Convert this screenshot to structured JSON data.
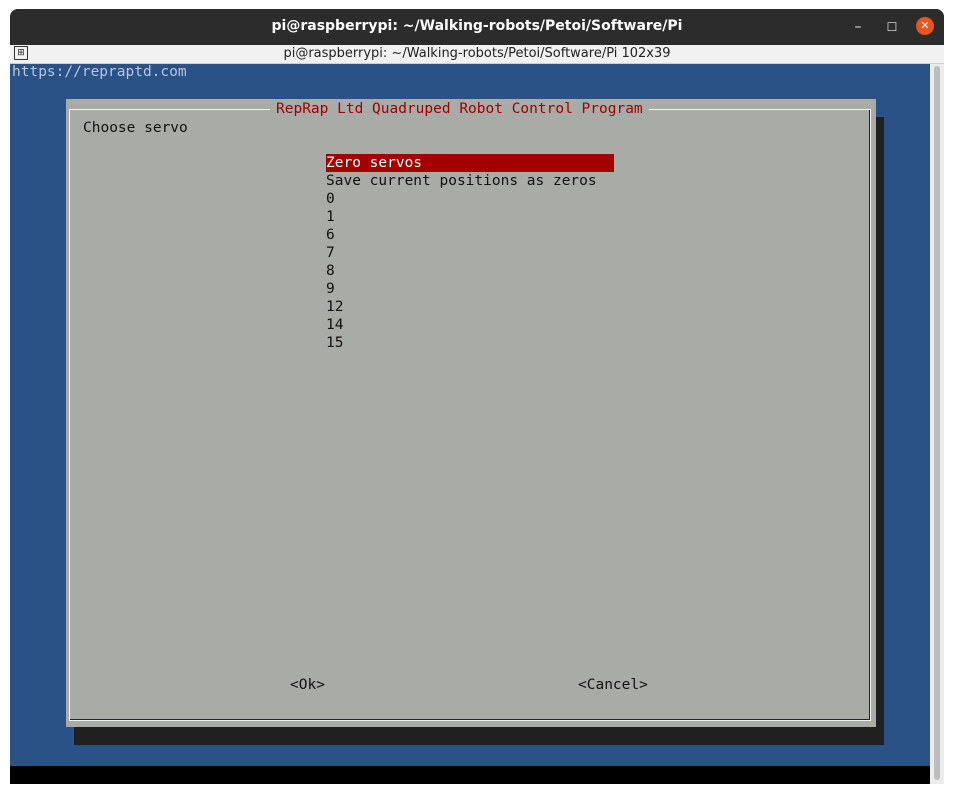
{
  "window": {
    "title": "pi@raspberrypi: ~/Walking-robots/Petoi/Software/Pi",
    "minimize_glyph": "–",
    "maximize_glyph": "☐",
    "close_glyph": "✕"
  },
  "tab": {
    "title": "pi@raspberrypi: ~/Walking-robots/Petoi/Software/Pi 102x39"
  },
  "terminal": {
    "backtitle": "https://repraptd.com"
  },
  "dialog": {
    "title": "RepRap Ltd Quadruped Robot Control Program",
    "prompt": "Choose servo",
    "items": [
      {
        "label": "Zero servos",
        "selected": true
      },
      {
        "label": "Save current positions as zeros",
        "selected": false
      },
      {
        "label": "0",
        "selected": false
      },
      {
        "label": "1",
        "selected": false
      },
      {
        "label": "6",
        "selected": false
      },
      {
        "label": "7",
        "selected": false
      },
      {
        "label": "8",
        "selected": false
      },
      {
        "label": "9",
        "selected": false
      },
      {
        "label": "12",
        "selected": false
      },
      {
        "label": "14",
        "selected": false
      },
      {
        "label": "15",
        "selected": false
      }
    ],
    "ok_label": "<Ok>",
    "cancel_label": "<Cancel>"
  },
  "colors": {
    "terminal_bg": "#2a5287",
    "dialog_bg": "#a9aba6",
    "title_color": "#a00000",
    "selection_bg": "#a40000",
    "close_button": "#e95420"
  }
}
